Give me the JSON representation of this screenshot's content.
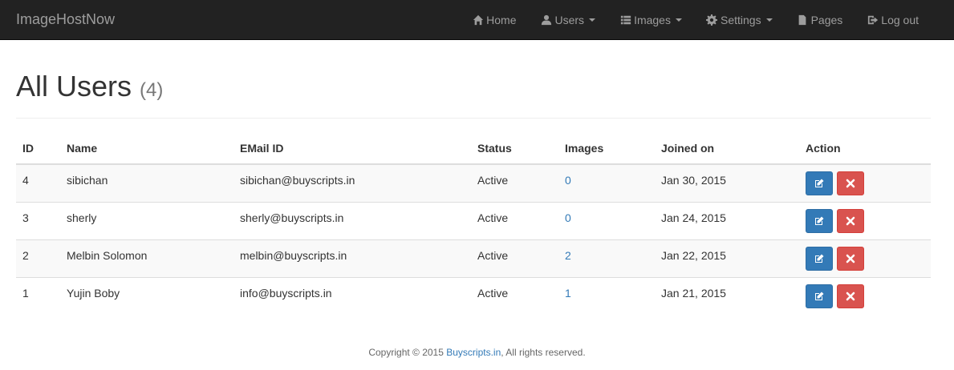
{
  "navbar": {
    "brand": "ImageHostNow",
    "items": [
      {
        "label": "Home",
        "icon": "home-icon",
        "dropdown": false
      },
      {
        "label": "Users",
        "icon": "user-icon",
        "dropdown": true
      },
      {
        "label": "Images",
        "icon": "list-icon",
        "dropdown": true
      },
      {
        "label": "Settings",
        "icon": "gear-icon",
        "dropdown": true
      },
      {
        "label": "Pages",
        "icon": "file-icon",
        "dropdown": false
      },
      {
        "label": "Log out",
        "icon": "logout-icon",
        "dropdown": false
      }
    ]
  },
  "page": {
    "title": "All Users",
    "count": "(4)"
  },
  "table": {
    "headers": [
      "ID",
      "Name",
      "EMail ID",
      "Status",
      "Images",
      "Joined on",
      "Action"
    ],
    "rows": [
      {
        "id": "4",
        "name": "sibichan",
        "email": "sibichan@buyscripts.in",
        "status": "Active",
        "images": "0",
        "joined": "Jan 30, 2015"
      },
      {
        "id": "3",
        "name": "sherly",
        "email": "sherly@buyscripts.in",
        "status": "Active",
        "images": "0",
        "joined": "Jan 24, 2015"
      },
      {
        "id": "2",
        "name": "Melbin Solomon",
        "email": "melbin@buyscripts.in",
        "status": "Active",
        "images": "2",
        "joined": "Jan 22, 2015"
      },
      {
        "id": "1",
        "name": "Yujin Boby",
        "email": "info@buyscripts.in",
        "status": "Active",
        "images": "1",
        "joined": "Jan 21, 2015"
      }
    ]
  },
  "footer": {
    "prefix": "Copyright © 2015 ",
    "link": "Buyscripts.in",
    "suffix": ", All rights reserved."
  },
  "colors": {
    "navbar_bg": "#222222",
    "nav_text": "#9d9d9d",
    "link": "#337ab7",
    "edit_button": "#337ab7",
    "delete_button": "#d9534f"
  }
}
